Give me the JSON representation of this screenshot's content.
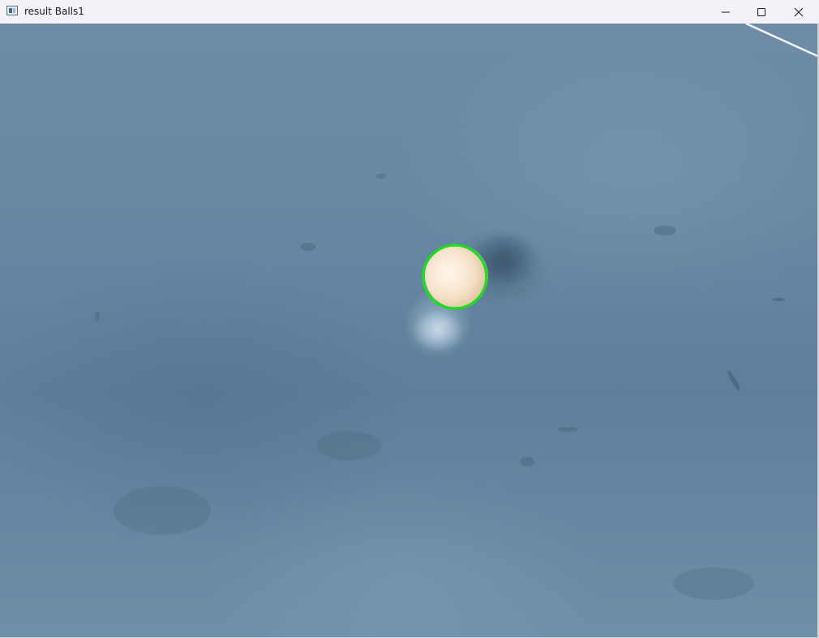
{
  "window": {
    "title": "result Balls1",
    "app_icon": "opencv-window-icon",
    "controls": {
      "minimize": "minimize-icon",
      "maximize": "maximize-icon",
      "close": "close-icon"
    }
  },
  "image": {
    "subject": "table-tennis-ball",
    "detections": [
      {
        "label": "ball-detection-circle",
        "color": "#1fdc1f"
      }
    ],
    "colors": {
      "surface": "#6687a3",
      "ball": "#f3dcc4",
      "detection_outline": "#1fdc1f"
    }
  }
}
